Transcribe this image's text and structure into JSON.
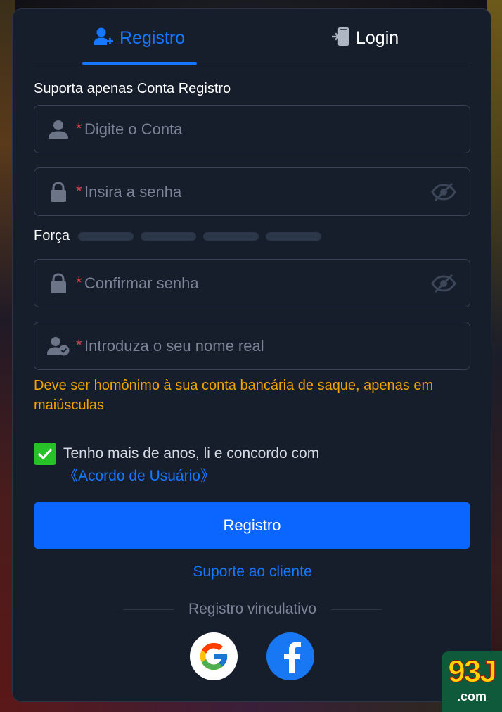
{
  "tabs": {
    "register_label": "Registro",
    "login_label": "Login"
  },
  "form": {
    "section_label": "Suporta apenas Conta Registro",
    "required_mark": "*",
    "account_placeholder": "Digite o Conta",
    "password_placeholder": "Insira a senha",
    "strength_label": "Força",
    "confirm_placeholder": "Confirmar senha",
    "realname_placeholder": "Introduza o seu nome real",
    "realname_warning": "Deve ser homônimo à sua conta bancária de saque, apenas em maiúsculas"
  },
  "agreement": {
    "checked": true,
    "text": "Tenho mais de anos, li e concordo com ",
    "link": "《Acordo de Usuário》"
  },
  "actions": {
    "submit_label": "Registro",
    "support_label": "Suporte ao cliente",
    "binding_label": "Registro vinculativo"
  },
  "brand": {
    "logo_top": "93J",
    "logo_bottom": ".com"
  },
  "colors": {
    "accent": "#1677ff",
    "button": "#0a66ff",
    "warning": "#f0a500",
    "required": "#e0434b",
    "checkbox": "#27c227",
    "panel": "#161d2b"
  }
}
